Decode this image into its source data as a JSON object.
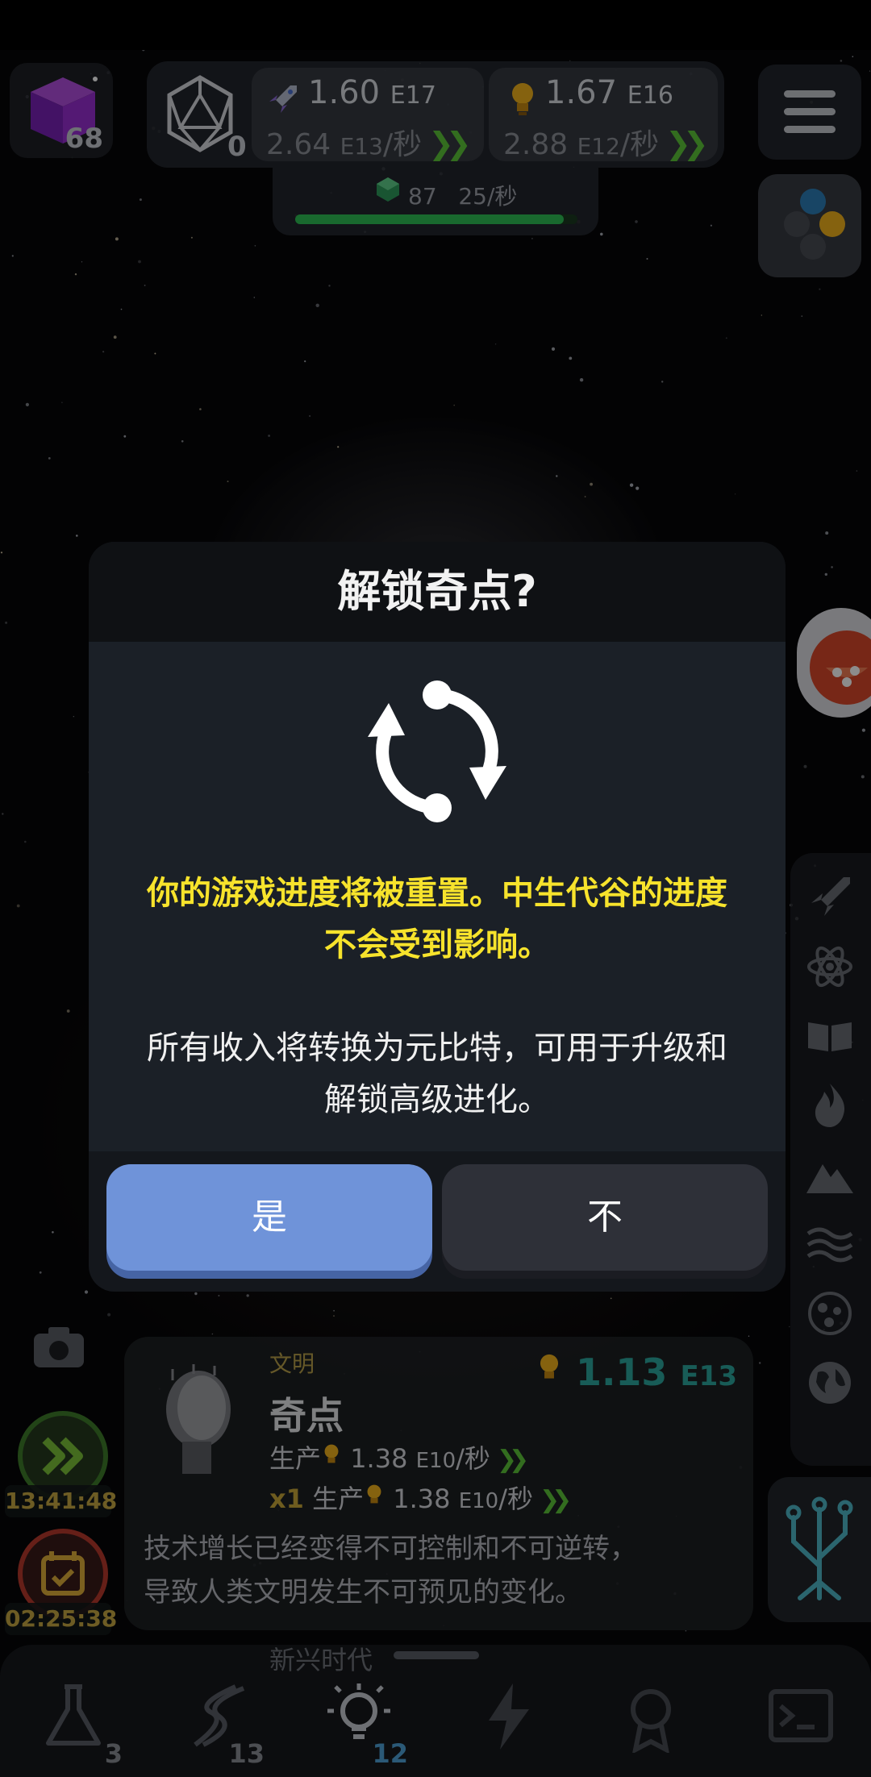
{
  "top": {
    "cube_count": "68",
    "d20_count": "0",
    "resources": [
      {
        "icon": "rocket-icon",
        "amount": "1.60",
        "exponent": "E17",
        "rate": "2.64",
        "rate_exponent": "E13",
        "rate_unit": "/秒"
      },
      {
        "icon": "lightbulb-icon",
        "amount": "1.67",
        "exponent": "E16",
        "rate": "2.88",
        "rate_exponent": "E12",
        "rate_unit": "/秒"
      }
    ],
    "gems": {
      "value": "87",
      "rate": "25/秒",
      "progress": 0.95
    }
  },
  "modal": {
    "title": "解锁奇点?",
    "warning_line1": "你的游戏进度将被重置。中生代谷的进度",
    "warning_line2": "不会受到影响。",
    "info_line1": "所有收入将转换为元比特，可用于升级和",
    "info_line2": "解锁高级进化。",
    "yes_label": "是",
    "no_label": "不"
  },
  "card": {
    "category": "文明",
    "title": "奇点",
    "amount": "1.13",
    "amount_exponent": "E13",
    "prod_label": "生产",
    "prod_value": "1.38",
    "prod_exponent": "E10",
    "prod_unit": "/秒",
    "mult_label": "x1",
    "mult_prod_label": "生产",
    "mult_prod_value": "1.38",
    "mult_prod_exponent": "E10",
    "mult_prod_unit": "/秒",
    "description_line1": "技术增长已经变得不可控制和不可逆转，",
    "description_line2": "导致人类文明发生不可预见的变化。"
  },
  "timers": {
    "boost": "13:41:48",
    "calendar": "02:25:38"
  },
  "bottom": {
    "era_label": "新兴时代",
    "tabs": [
      {
        "name": "science",
        "icon": "flask-icon",
        "count": "3"
      },
      {
        "name": "dna",
        "icon": "dna-icon",
        "count": "13"
      },
      {
        "name": "ideas",
        "icon": "lightbulb-icon",
        "count": "12"
      },
      {
        "name": "power",
        "icon": "lightning-icon",
        "count": ""
      },
      {
        "name": "achievements",
        "icon": "medal-icon",
        "count": ""
      },
      {
        "name": "terminal",
        "icon": "terminal-icon",
        "count": ""
      }
    ]
  },
  "colors": {
    "accent_yes": "#6f93d9",
    "warning_text": "#f7e32c",
    "chevron": "#5dc63a",
    "card_amount": "#2ca89e"
  }
}
